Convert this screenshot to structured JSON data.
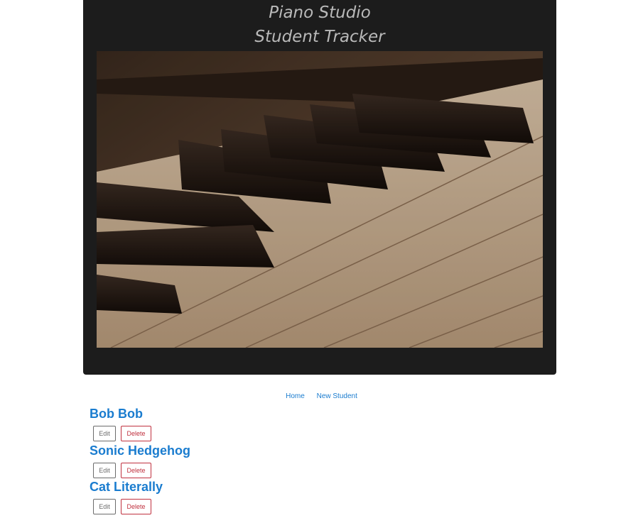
{
  "header": {
    "title_line1": "Piano Studio",
    "title_line2": "Student Tracker"
  },
  "nav": {
    "home_label": "Home",
    "new_student_label": "New Student"
  },
  "students": [
    {
      "name": "Bob Bob",
      "edit_label": "Edit",
      "delete_label": "Delete"
    },
    {
      "name": "Sonic Hedgehog",
      "edit_label": "Edit",
      "delete_label": "Delete"
    },
    {
      "name": "Cat Literally",
      "edit_label": "Edit",
      "delete_label": "Delete"
    }
  ],
  "colors": {
    "header_bg": "#1c1c1c",
    "link": "#1a7ccf",
    "delete": "#c0313f",
    "edit": "#6c6c6c"
  },
  "icons": {
    "hero": "piano-keys-image"
  }
}
